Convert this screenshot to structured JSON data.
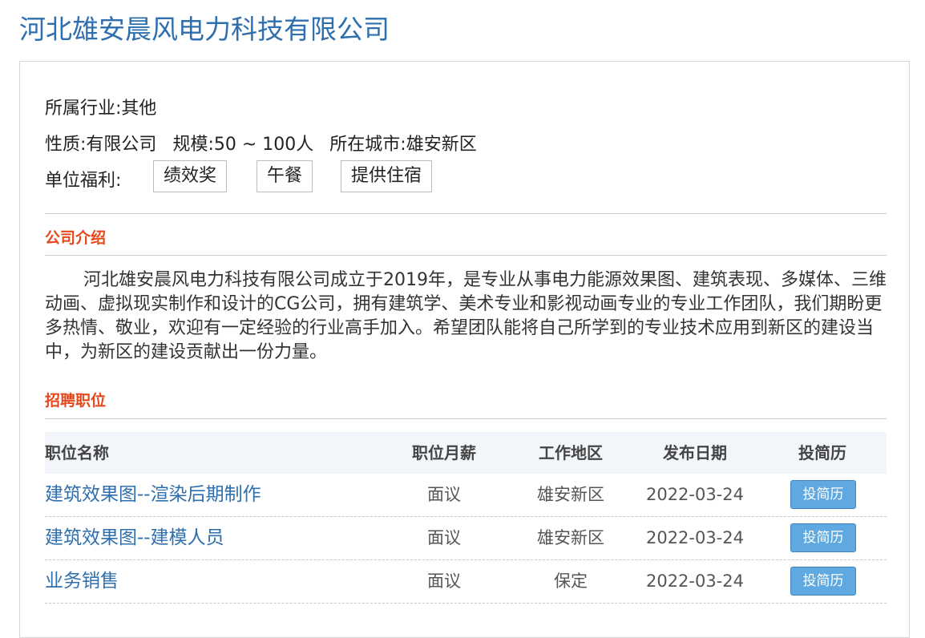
{
  "company": {
    "name": "河北雄安晨风电力科技有限公司"
  },
  "info": {
    "industry_label": "所属行业:",
    "industry_value": "其他",
    "nature_label": "性质:",
    "nature_value": "有限公司",
    "scale_label": "规模:",
    "scale_value": "50 ~ 100人",
    "city_label": "所在城市:",
    "city_value": "雄安新区",
    "welfare_label": "单位福利:",
    "welfare": [
      "绩效奖",
      "午餐",
      "提供住宿"
    ]
  },
  "intro": {
    "title": "公司介绍",
    "text": "河北雄安晨风电力科技有限公司成立于2019年，是专业从事电力能源效果图、建筑表现、多媒体、三维动画、虚拟现实制作和设计的CG公司，拥有建筑学、美术专业和影视动画专业的专业工作团队，我们期盼更多热情、敬业，欢迎有一定经验的行业高手加入。希望团队能将自己所学到的专业技术应用到新区的建设当中，为新区的建设贡献出一份力量。"
  },
  "jobs": {
    "title": "招聘职位",
    "headers": {
      "name": "职位名称",
      "salary": "职位月薪",
      "area": "工作地区",
      "date": "发布日期",
      "apply": "投简历"
    },
    "rows": [
      {
        "name": "建筑效果图--渲染后期制作",
        "salary": "面议",
        "area": "雄安新区",
        "date": "2022-03-24",
        "apply": "投简历"
      },
      {
        "name": "建筑效果图--建模人员",
        "salary": "面议",
        "area": "雄安新区",
        "date": "2022-03-24",
        "apply": "投简历"
      },
      {
        "name": "业务销售",
        "salary": "面议",
        "area": "保定",
        "date": "2022-03-24",
        "apply": "投简历"
      }
    ]
  },
  "colors": {
    "title": "#2f6fad",
    "section": "#e4481b",
    "button": "#5fa9e0"
  }
}
